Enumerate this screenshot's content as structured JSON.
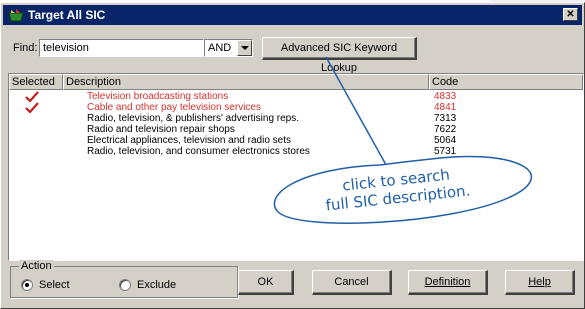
{
  "window": {
    "title": "Target All SIC",
    "close_symbol": "✕"
  },
  "search": {
    "find_label": "Find:",
    "query": "television",
    "operator": "AND",
    "advanced_button_label": "Advanced SIC Keyword Lookup"
  },
  "list": {
    "columns": [
      "Selected",
      "Description",
      "Code"
    ],
    "rows": [
      {
        "selected": true,
        "description": "Television broadcasting stations",
        "code": "4833"
      },
      {
        "selected": true,
        "description": "Cable and other pay television services",
        "code": "4841"
      },
      {
        "selected": false,
        "description": "Radio, television, & publishers' advertising reps.",
        "code": "7313"
      },
      {
        "selected": false,
        "description": "Radio and television repair shops",
        "code": "7622"
      },
      {
        "selected": false,
        "description": "Electrical appliances, television and radio sets",
        "code": "5064"
      },
      {
        "selected": false,
        "description": "Radio, television, and consumer electronics stores",
        "code": "5731"
      }
    ]
  },
  "callout": {
    "line1": "click to search",
    "line2": "full SIC description."
  },
  "action": {
    "legend": "Action",
    "options": [
      "Select",
      "Exclude"
    ],
    "selected": "Select"
  },
  "buttons": {
    "ok": "OK",
    "cancel": "Cancel",
    "definition": "Definition",
    "help": "Help"
  },
  "colors": {
    "selected_text": "#d9322c",
    "checkmark": "#c41e1e",
    "callout": "#1f5fa8",
    "titlebar": "#0a246a"
  }
}
